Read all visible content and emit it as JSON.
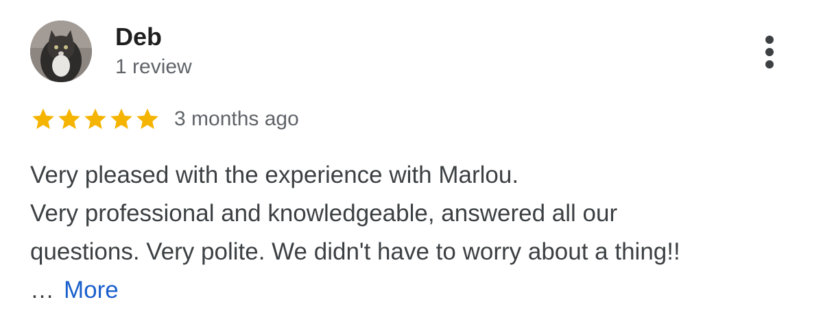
{
  "reviewer": {
    "name": "Deb",
    "review_count": "1 review"
  },
  "rating": {
    "stars": 5,
    "max_stars": 5,
    "star_color": "#f5b400",
    "time_ago": "3 months ago"
  },
  "review": {
    "lines": [
      "Very pleased with the experience with Marlou.",
      "Very professional and knowledgeable, answered all our",
      "questions. Very polite. We didn't have to worry about a thing!!"
    ],
    "ellipsis": "…",
    "more_label": "More",
    "link_color": "#1a5fcc"
  },
  "icons": {
    "menu": "more-vert-icon",
    "star": "star-icon"
  }
}
